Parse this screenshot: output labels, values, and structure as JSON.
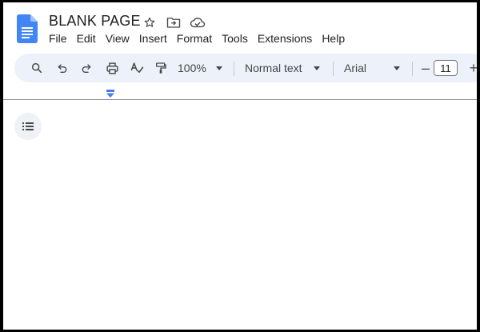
{
  "document": {
    "title": "BLANK PAGE"
  },
  "title_icons": [
    {
      "icon": "star-icon"
    },
    {
      "icon": "move-to-folder-icon"
    },
    {
      "icon": "cloud-saved-icon"
    }
  ],
  "menu": {
    "items": [
      "File",
      "Edit",
      "View",
      "Insert",
      "Format",
      "Tools",
      "Extensions",
      "Help"
    ]
  },
  "toolbar": {
    "zoom": "100%",
    "style": "Normal text",
    "font": "Arial",
    "font_size": "11",
    "decrease_symbol": "–",
    "increase_symbol": "+"
  },
  "colors": {
    "docs_blue": "#4285f4",
    "toolbar_bg": "#edf2fa",
    "ruler_marker": "#4a7ce8"
  }
}
